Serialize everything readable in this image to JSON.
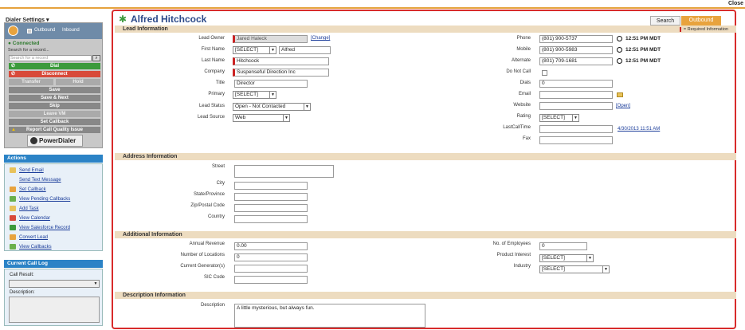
{
  "topbar": {
    "close": "Close"
  },
  "dialer": {
    "settings": "Dialer Settings",
    "outbound": "Outbound",
    "inbound": "Inbound",
    "status": "Connected",
    "search_label": "Search for a record...",
    "search_placeholder": "Search for a record",
    "dial": "Dial",
    "disconnect": "Disconnect",
    "transfer": "Transfer",
    "hold": "Hold",
    "save": "Save",
    "save_next": "Save & Next",
    "skip": "Skip",
    "leave_vm": "Leave VM",
    "set_callback": "Set Callback",
    "report": "Report Call Quality Issue",
    "brand": "PowerDialer",
    "colors": {
      "dial": "#3c9a3c",
      "disconnect": "#d84a3a",
      "gray": "#888",
      "disabled": "#aaa"
    }
  },
  "actions": {
    "title": "Actions",
    "items": [
      "Send Email",
      "Send Text Message",
      "Set Callback",
      "View Pending Callbacks",
      "Add Task",
      "View Calendar",
      "View Salesforce Record",
      "Convert Lead",
      "View Callbacks"
    ]
  },
  "calllog": {
    "title": "Current Call Log",
    "result_label": "Call Result:",
    "desc_label": "Description:"
  },
  "header": {
    "title": "Alfred Hitchcock",
    "search_tab": "Search",
    "outbound_tab": "Outbound"
  },
  "lead": {
    "section": "Lead Information",
    "required": "= Required Information",
    "owner_label": "Lead Owner",
    "owner": "Jared Haleck",
    "change": "[Change]",
    "first_label": "First Name",
    "salutation": "[SELECT]",
    "first": "Alfred",
    "last_label": "Last Name",
    "last": "Hitchcock",
    "company_label": "Company",
    "company": "Suspenseful Direction Inc",
    "title_label": "Title",
    "title": "Director",
    "primary_label": "Primary",
    "primary": "[SELECT]",
    "status_label": "Lead Status",
    "status": "Open - Not Contacted",
    "source_label": "Lead Source",
    "source": "Web",
    "phone_label": "Phone",
    "phone": "(801) 900-5737",
    "phone_time": "12:51 PM MDT",
    "mobile_label": "Mobile",
    "mobile": "(801) 900-5983",
    "mobile_time": "12:51 PM MDT",
    "alt_label": "Alternate",
    "alt": "(801) 709-1681",
    "alt_time": "12:51 PM MDT",
    "dnc_label": "Do Not Call",
    "dials_label": "Dials",
    "dials": "0",
    "email_label": "Email",
    "website_label": "Website",
    "open": "[Open]",
    "rating_label": "Rating",
    "rating": "[SELECT]",
    "lastcall_label": "LastCallTime",
    "lastcall": "4/30/2013 11:51 AM",
    "fax_label": "Fax"
  },
  "address": {
    "section": "Address Information",
    "street": "Street",
    "city": "City",
    "state": "State/Province",
    "zip": "Zip/Postal Code",
    "country": "Country"
  },
  "additional": {
    "section": "Additional Information",
    "revenue_label": "Annual Revenue",
    "revenue": "0.00",
    "locations_label": "Number of Locations",
    "locations": "0",
    "generator_label": "Current Generator(s)",
    "sic_label": "SIC Code",
    "employees_label": "No. of Employees",
    "employees": "0",
    "interest_label": "Product Interest",
    "interest": "[SELECT]",
    "industry_label": "Industry",
    "industry": "[SELECT]"
  },
  "description": {
    "section": "Description Information",
    "label": "Description",
    "value": "A little mysterious, but always fun."
  }
}
